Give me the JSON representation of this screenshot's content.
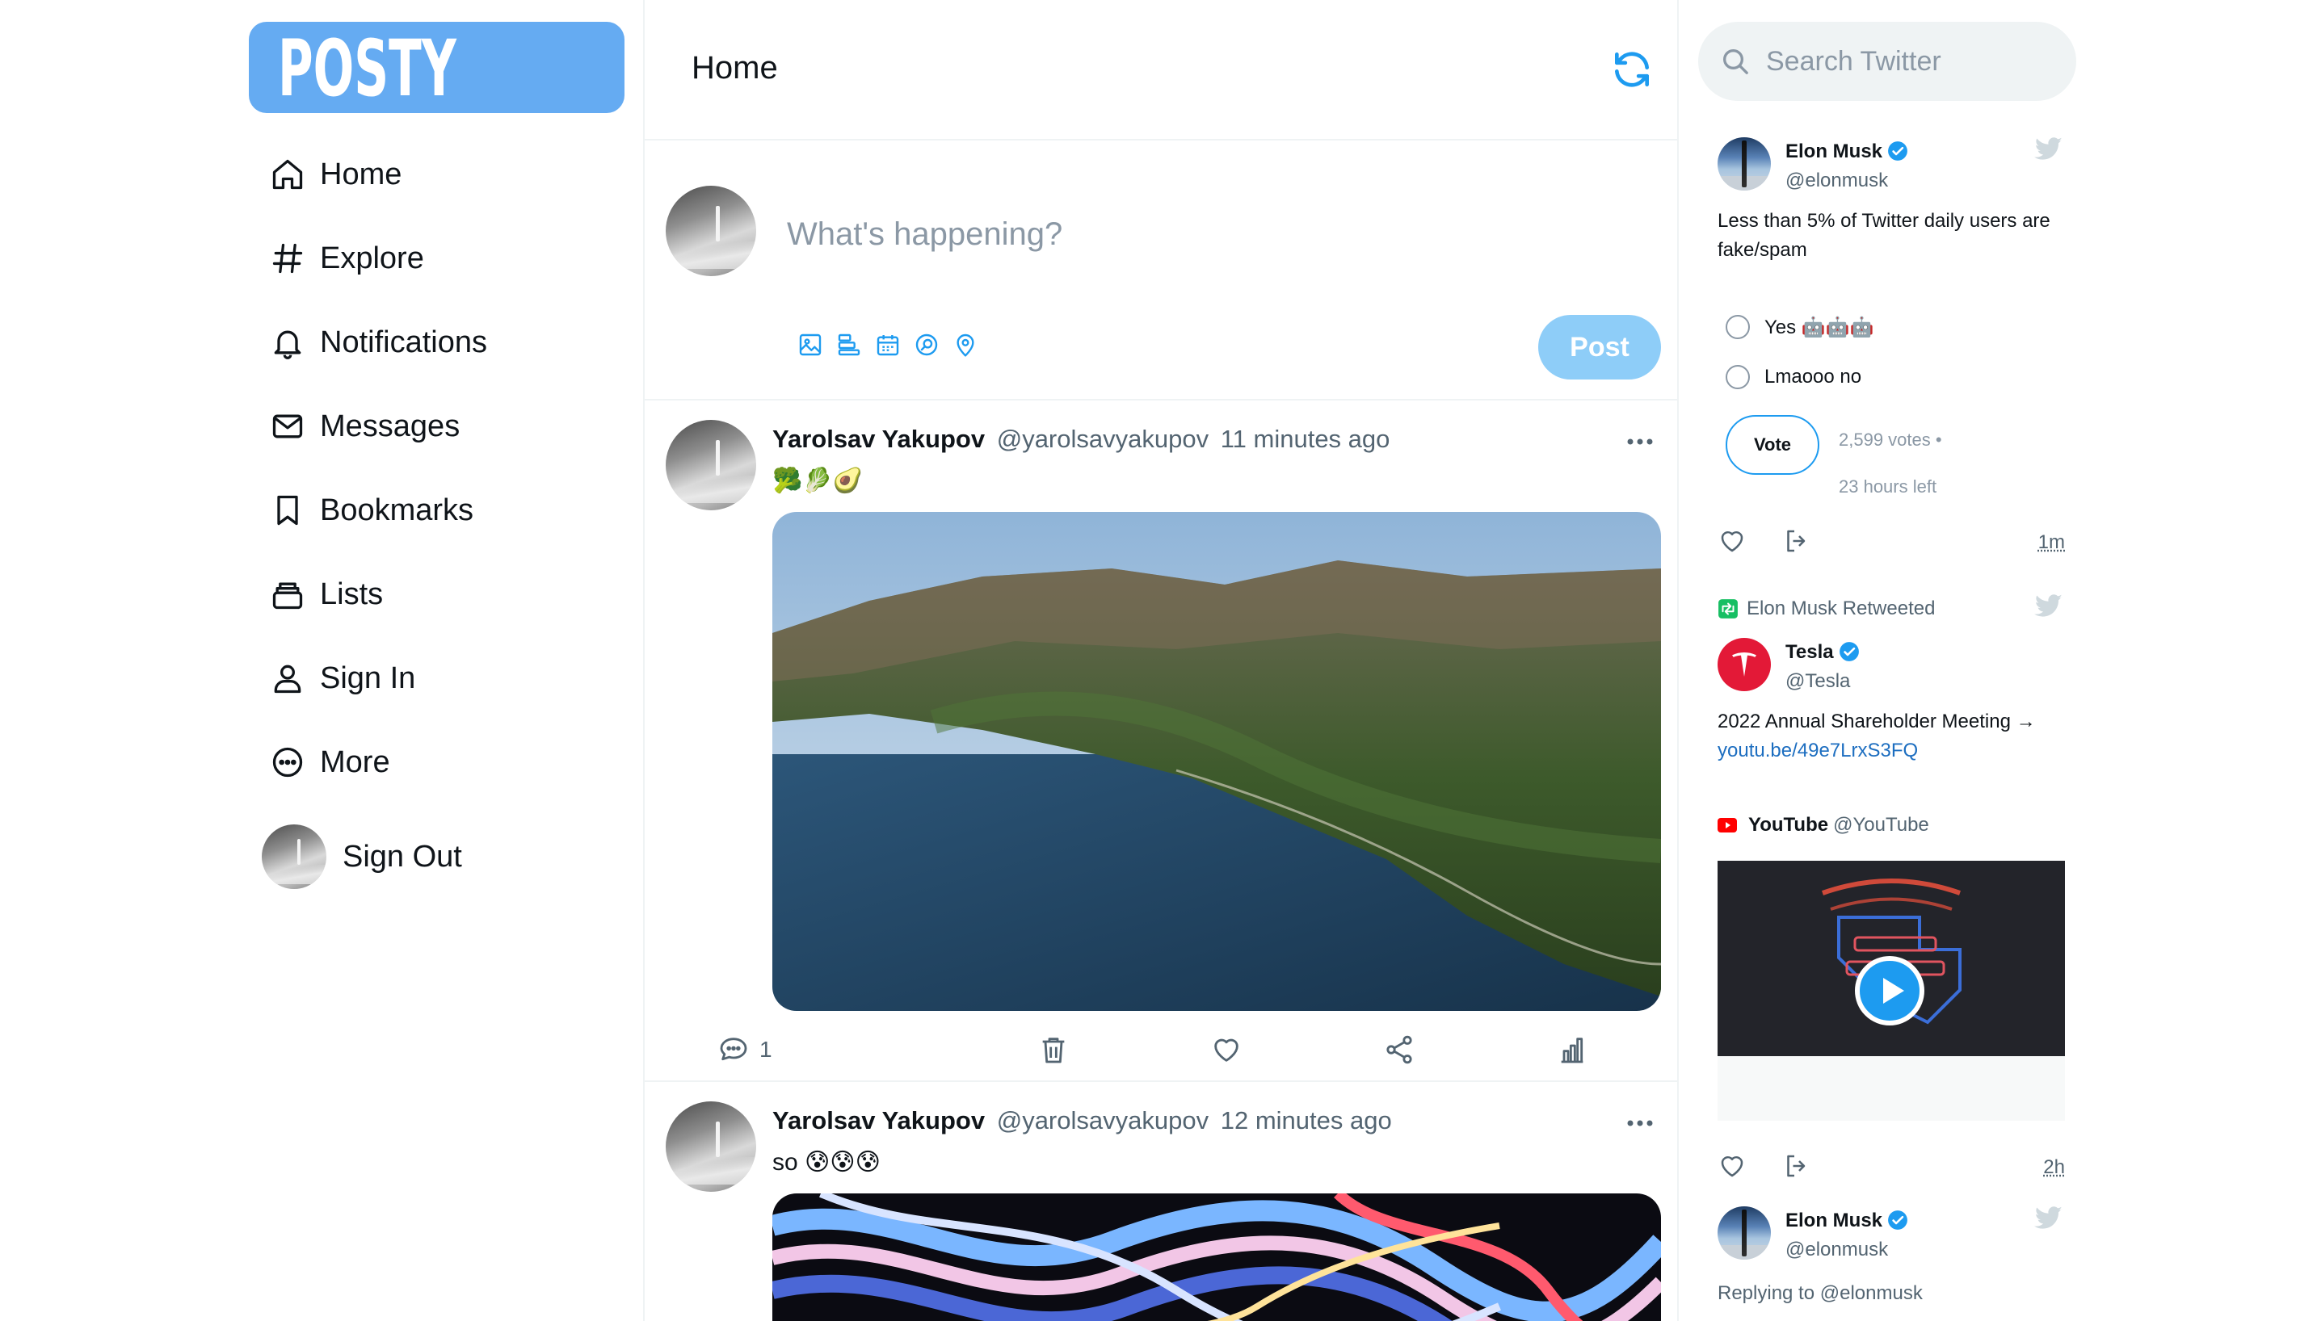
{
  "brand": {
    "logo_text": "POSTY",
    "accent": "#65abf2",
    "post_button_color": "#8ecdf8"
  },
  "sidebar": {
    "items": [
      {
        "label": "Home",
        "icon": "home-icon"
      },
      {
        "label": "Explore",
        "icon": "hashtag-icon"
      },
      {
        "label": "Notifications",
        "icon": "bell-icon"
      },
      {
        "label": "Messages",
        "icon": "envelope-icon"
      },
      {
        "label": "Bookmarks",
        "icon": "bookmark-icon"
      },
      {
        "label": "Lists",
        "icon": "lists-icon"
      },
      {
        "label": "Sign In",
        "icon": "user-icon"
      },
      {
        "label": "More",
        "icon": "more-circle-icon"
      }
    ],
    "signout_label": "Sign Out"
  },
  "main": {
    "title": "Home",
    "composer": {
      "placeholder": "What's happening?",
      "tools": [
        "image-icon",
        "poll-icon",
        "schedule-icon",
        "search-media-icon",
        "location-icon"
      ],
      "post_label": "Post"
    },
    "posts": [
      {
        "name": "Yarolsav Yakupov",
        "handle": "@yarolsavyakupov",
        "time": "11 minutes ago",
        "text": "🥦🥬🥑",
        "media": "mountain-coast-photo",
        "actions": {
          "comments": "1"
        }
      },
      {
        "name": "Yarolsav Yakupov",
        "handle": "@yarolsavyakupov",
        "time": "12 minutes ago",
        "text": "so 😰😰😰",
        "media": "abstract-wave-image"
      }
    ]
  },
  "right": {
    "search_placeholder": "Search Twitter",
    "tweet1": {
      "name": "Elon Musk",
      "handle": "@elonmusk",
      "text": "Less than 5% of Twitter daily users are fake/spam",
      "poll": {
        "options": [
          "Yes 🤖🤖🤖",
          "Lmaooo no"
        ],
        "vote_label": "Vote",
        "votes": "2,599 votes •",
        "time_left": "23 hours left"
      },
      "time": "1m"
    },
    "tweet2": {
      "retweet_label": "Elon Musk Retweeted",
      "name": "Tesla",
      "handle": "@Tesla",
      "text": "2022 Annual Shareholder Meeting →",
      "link": "youtu.be/49e7LrxS3FQ",
      "card_source_name": "YouTube",
      "card_source_handle": "@YouTube",
      "time": "2h"
    },
    "tweet3": {
      "name": "Elon Musk",
      "handle": "@elonmusk",
      "reply_label": "Replying to @elonmusk"
    }
  }
}
